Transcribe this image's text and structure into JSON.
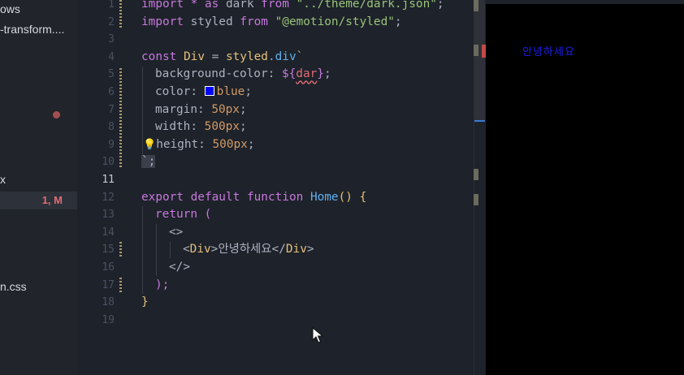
{
  "explorer": {
    "items": [
      {
        "label": "ows"
      },
      {
        "label": "-transform...."
      },
      {
        "label": "x"
      },
      {
        "label": "",
        "badge": "1, M"
      },
      {
        "label": "n.css"
      }
    ]
  },
  "gutter": {
    "line_numbers": [
      "1",
      "2",
      "3",
      "4",
      "5",
      "6",
      "7",
      "8",
      "9",
      "10",
      "11",
      "12",
      "13",
      "14",
      "15",
      "16",
      "17",
      "18",
      "19"
    ],
    "current_line": "11"
  },
  "code": {
    "l1_kw1": "import",
    "l1_rest1": " * ",
    "l1_kw2": "as",
    "l1_name": " dark ",
    "l1_kw3": "from",
    "l1_str": " \"../theme/dark.json\"",
    "l1_end": ";",
    "l2_kw1": "import",
    "l2_name": " styled ",
    "l2_kw2": "from",
    "l2_str": " \"@emotion/styled\"",
    "l2_end": ";",
    "l4_kw": "const",
    "l4_name": " Div",
    "l4_eq": " = ",
    "l4_styled": "styled",
    "l4_div": ".div",
    "l4_tick": "`",
    "l5_prop": "background-color: ",
    "l5_interp_open": "${",
    "l5_interp_val": "dar",
    "l5_interp_close": "}",
    "l5_end": ";",
    "l6_prop": "color: ",
    "l6_val": "blue",
    "l6_end": ";",
    "l7_prop": "margin: ",
    "l7_val": "50px",
    "l7_end": ";",
    "l8_prop": "width: ",
    "l8_val": "500px",
    "l8_end": ";",
    "l9_bulb": "💡",
    "l9_prop": "height: ",
    "l9_val": "500px",
    "l9_end": ";",
    "l10_text": "`;",
    "l12_kw1": "export",
    "l12_kw2": " default",
    "l12_kw3": " function",
    "l12_fn": " Home",
    "l12_end": "() {",
    "l13_kw": "return",
    "l13_end": " (",
    "l14_text": "<>",
    "l15_open": "<",
    "l15_tag1": "Div",
    "l15_mid": ">안녕하세요</",
    "l15_tag2": "Div",
    "l15_close": ">",
    "l16_text": "</>",
    "l17_text": ");",
    "l18_text": "}"
  },
  "colors": {
    "swatch": "#0000ff"
  },
  "preview": {
    "text": "안녕하세요"
  }
}
